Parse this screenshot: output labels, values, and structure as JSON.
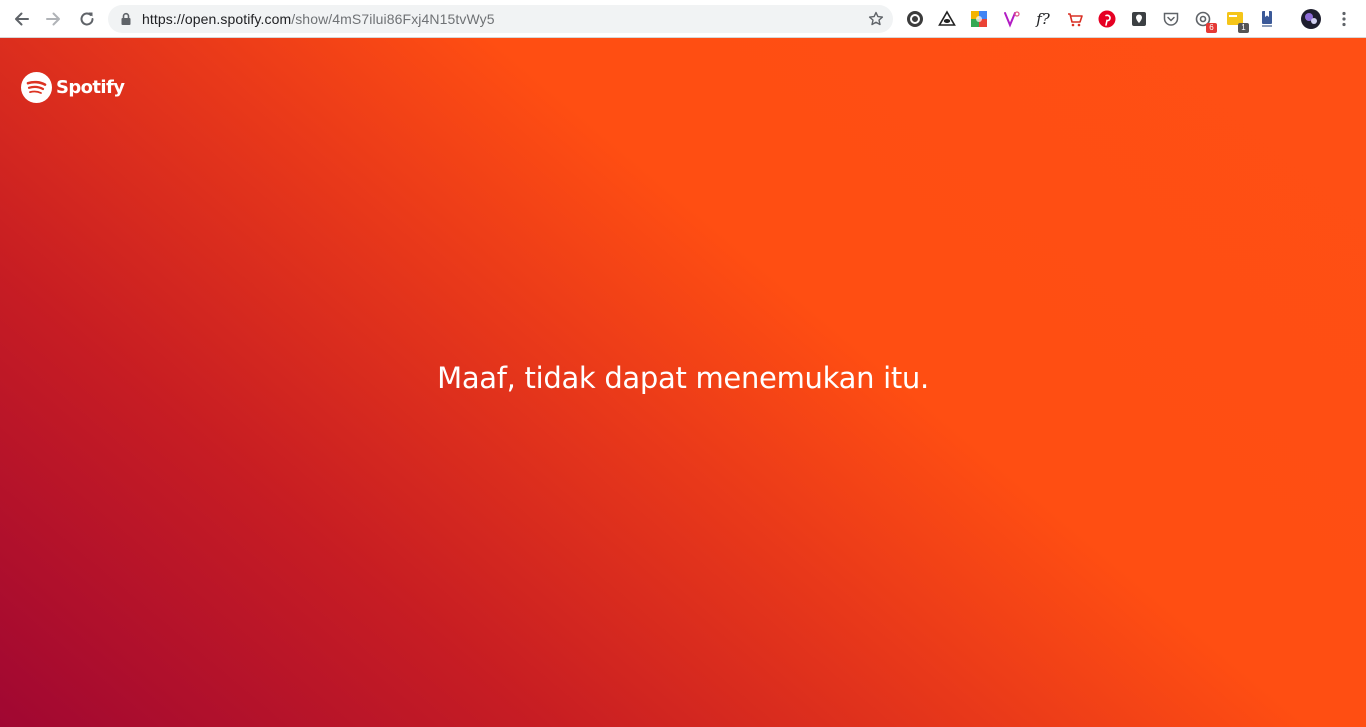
{
  "browser": {
    "url_host": "https://open.spotify.com",
    "url_path": "/show/4mS7ilui86Fxj4N15tvWy5",
    "nav": [
      "back-icon",
      "forward-icon",
      "reload-icon"
    ],
    "extensions": [
      {
        "name": "opera-like-icon",
        "badge": ""
      },
      {
        "name": "triangle-eye-icon",
        "badge": ""
      },
      {
        "name": "colorful-puzzle-icon",
        "badge": ""
      },
      {
        "name": "vimeo-clip-icon",
        "badge": ""
      },
      {
        "name": "font-question-icon",
        "label": "f?",
        "badge": ""
      },
      {
        "name": "cart-icon",
        "badge": ""
      },
      {
        "name": "pinterest-icon",
        "badge": ""
      },
      {
        "name": "shield-check-icon",
        "badge": ""
      },
      {
        "name": "pocket-icon",
        "badge": ""
      },
      {
        "name": "gear-badge-icon",
        "badge": "6",
        "badge_color": "#e53935"
      },
      {
        "name": "yellow-note-icon",
        "badge": "1",
        "badge_color": "#555555"
      },
      {
        "name": "bookmark-doc-icon",
        "badge": ""
      },
      {
        "name": "profile-avatar",
        "badge": ""
      },
      {
        "name": "menu-dots-icon",
        "badge": ""
      }
    ]
  },
  "page": {
    "logo_text": "Spotify",
    "message": "Maaf, tidak dapat menemukan itu.",
    "colors": {
      "gradient_start": "#a00732",
      "gradient_end": "#ff4f14",
      "text": "#ffffff"
    }
  }
}
